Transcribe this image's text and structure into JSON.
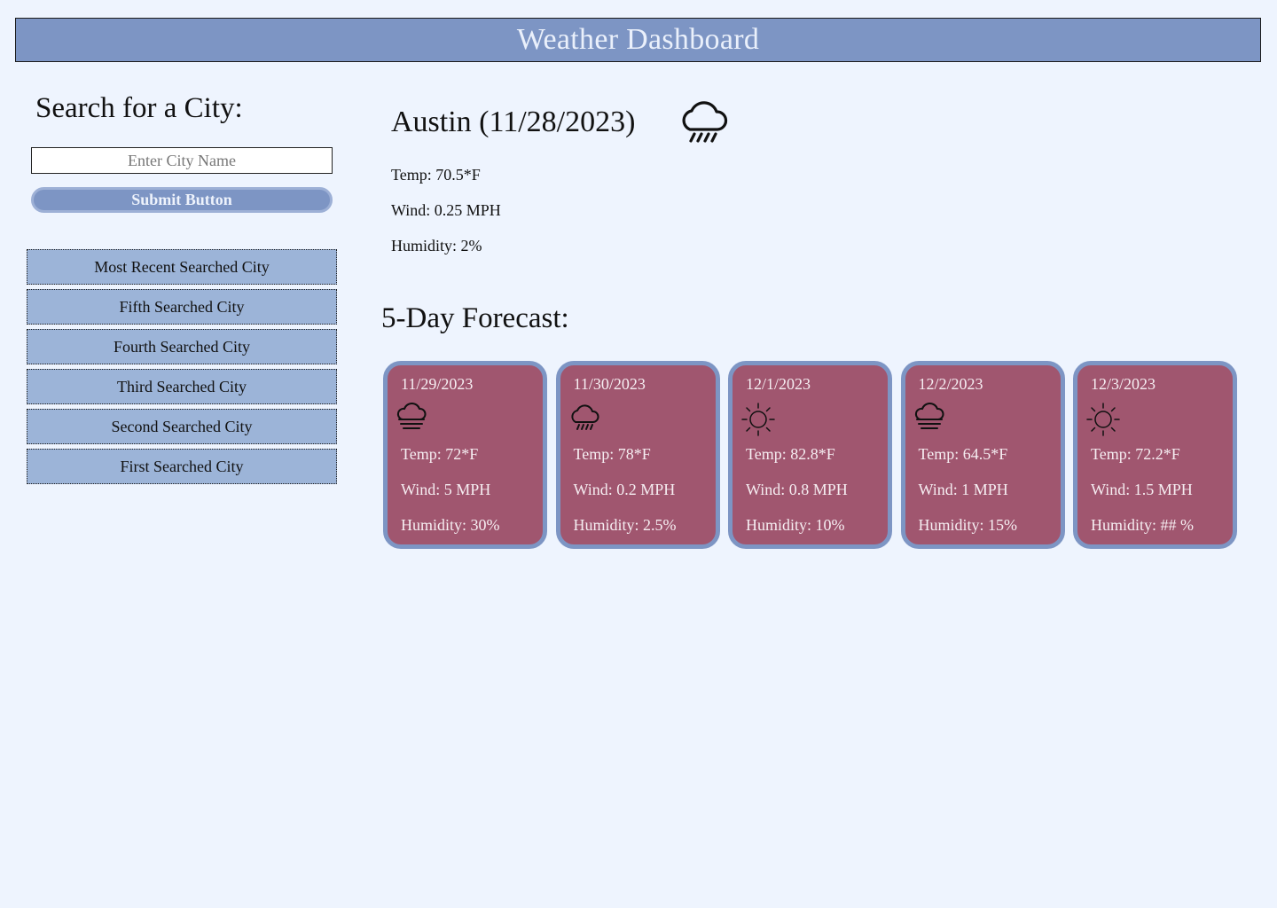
{
  "header": {
    "title": "Weather Dashboard"
  },
  "search": {
    "title": "Search for a City:",
    "placeholder": "Enter City Name",
    "value": "",
    "submit_label": "Submit Button"
  },
  "history": [
    {
      "label": "Most Recent Searched City"
    },
    {
      "label": "Fifth Searched City"
    },
    {
      "label": "Fourth Searched City"
    },
    {
      "label": "Third Searched City"
    },
    {
      "label": "Second Searched City"
    },
    {
      "label": "First Searched City"
    }
  ],
  "current": {
    "title": "Austin (11/28/2023)",
    "icon": "rain-cloud-icon",
    "temp": "Temp: 70.5*F",
    "wind": "Wind: 0.25 MPH",
    "humidity": "Humidity: 2%"
  },
  "forecast": {
    "title": "5-Day Forecast:",
    "days": [
      {
        "date": "11/29/2023",
        "icon": "fog-cloud-icon",
        "temp": "Temp: 72*F",
        "wind": "Wind: 5 MPH",
        "humidity": "Humidity: 30%"
      },
      {
        "date": "11/30/2023",
        "icon": "rain-cloud-icon",
        "temp": "Temp: 78*F",
        "wind": "Wind: 0.2 MPH",
        "humidity": "Humidity: 2.5%"
      },
      {
        "date": "12/1/2023",
        "icon": "sun-icon",
        "temp": "Temp: 82.8*F",
        "wind": "Wind: 0.8 MPH",
        "humidity": "Humidity: 10%"
      },
      {
        "date": "12/2/2023",
        "icon": "fog-cloud-icon",
        "temp": "Temp: 64.5*F",
        "wind": "Wind: 1 MPH",
        "humidity": "Humidity: 15%"
      },
      {
        "date": "12/3/2023",
        "icon": "sun-icon",
        "temp": "Temp: 72.2*F",
        "wind": "Wind: 1.5 MPH",
        "humidity": "Humidity: ## %"
      }
    ]
  },
  "colors": {
    "background": "#eef4fe",
    "header": "#7d95c4",
    "history_button": "#9cb4d8",
    "card": "#a0566f",
    "card_border": "#7d95c4"
  }
}
